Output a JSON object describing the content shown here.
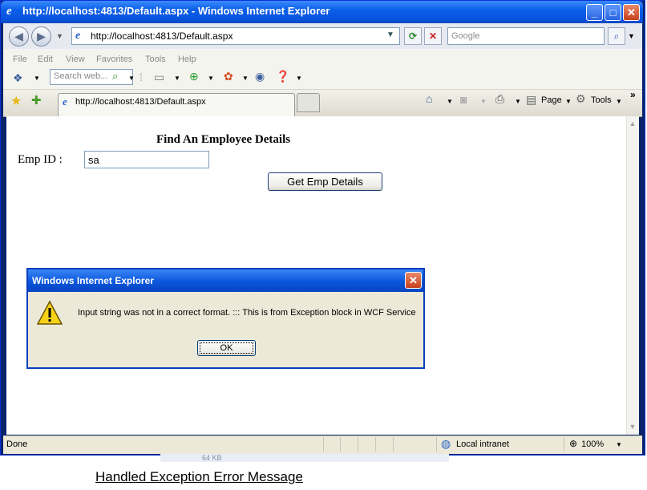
{
  "window": {
    "title": "http://localhost:4813/Default.aspx - Windows Internet Explorer"
  },
  "address": {
    "url": "http://localhost:4813/Default.aspx"
  },
  "search": {
    "placeholder": "Google"
  },
  "menu": [
    "File",
    "Edit",
    "View",
    "Favorites",
    "Tools",
    "Help"
  ],
  "toolbar": {
    "search_placeholder": "Search web...",
    "page_label": "Page",
    "tools_label": "Tools"
  },
  "tab": {
    "title": "http://localhost:4813/Default.aspx"
  },
  "page": {
    "title": "Find An Employee Details",
    "emp_label": "Emp ID :",
    "emp_value": "sa",
    "button": "Get Emp Details"
  },
  "dialog": {
    "title": "Windows Internet Explorer",
    "message": "Input string was not in a correct format.  :::  This is from Exception block in WCF Service",
    "ok": "OK"
  },
  "status": {
    "text": "Done",
    "zone": "Local intranet",
    "zoom": "100%"
  },
  "background": {
    "file_size": "64 KB"
  },
  "caption": "Handled Exception Error Message"
}
